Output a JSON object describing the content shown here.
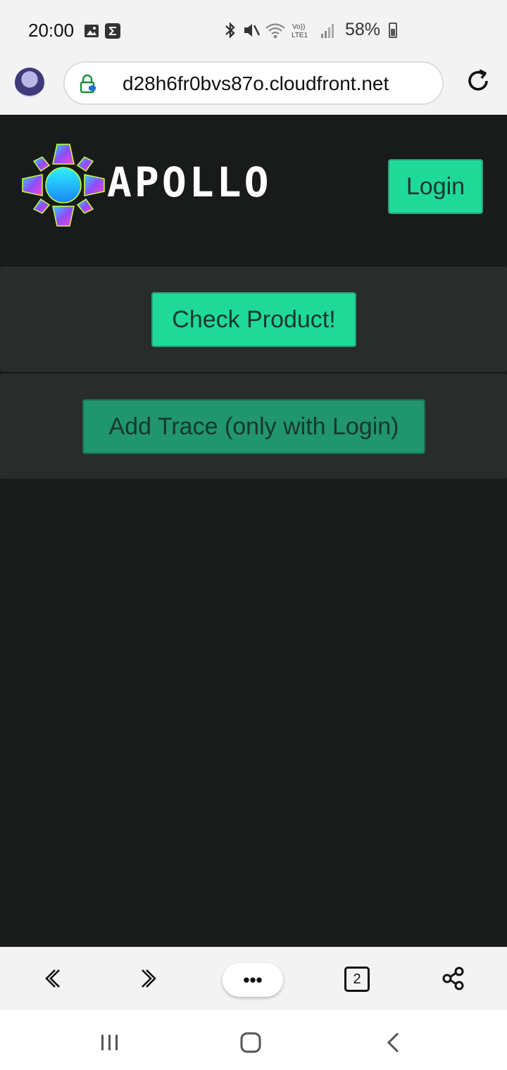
{
  "status_bar": {
    "time": "20:00",
    "battery": "58%"
  },
  "browser": {
    "url": "d28h6fr0bvs87o.cloudfront.net",
    "tab_count": "2",
    "menu_label": "•••"
  },
  "header": {
    "logo_text": "APOLLO",
    "login_label": "Login"
  },
  "actions": {
    "check_label": "Check Product!",
    "trace_label": "Add Trace (only with Login)"
  },
  "colors": {
    "page_bg": "#181b1a",
    "card_bg": "#282c2b",
    "primary_button": "#1fd999",
    "secondary_button": "#20956e"
  }
}
